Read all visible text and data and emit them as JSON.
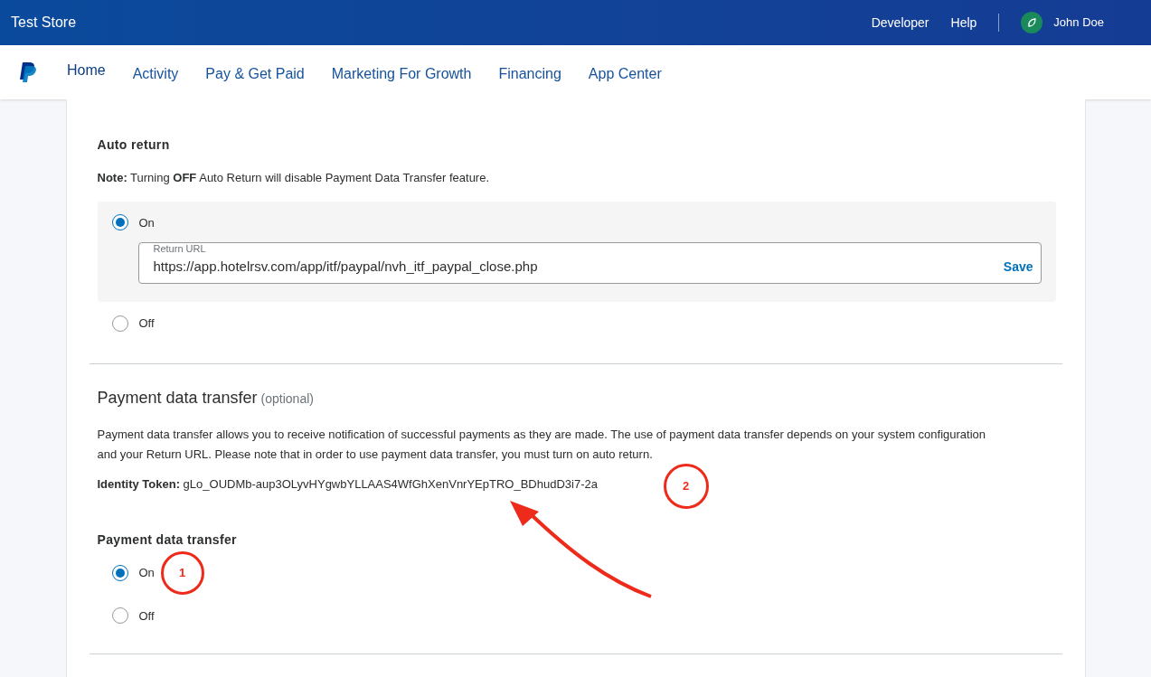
{
  "top_bar": {
    "store_name": "Test Store",
    "links": [
      "Developer",
      "Help"
    ],
    "user_name": "John Doe"
  },
  "nav": {
    "items": [
      {
        "label": "Home",
        "selected": true
      },
      {
        "label": "Activity",
        "selected": false
      },
      {
        "label": "Pay & Get Paid",
        "selected": false
      },
      {
        "label": "Marketing For Growth",
        "selected": false
      },
      {
        "label": "Financing",
        "selected": false
      },
      {
        "label": "App Center",
        "selected": false
      }
    ]
  },
  "auto_return": {
    "title": "Auto return",
    "note": "**Note:** Turning **OFF** Auto Return will disable Payment Data Transfer feature.",
    "options": [
      {
        "label": "On",
        "selected": true
      },
      {
        "label": "Off",
        "selected": false
      }
    ],
    "return_url": {
      "label": "Return URL",
      "value": "https://app.hotelrsv.com/app/itf/paypal/nvh_itf_paypal_close.php"
    },
    "save_button": "Save"
  },
  "payment_data_transfer": {
    "title": "Payment data transfer",
    "title_suffix": "(optional)",
    "description": "Payment data transfer allows you to receive notification of successful payments as they are made. The use of payment data transfer depends on your system configuration and your Return URL. Please note that in order to use payment data transfer, you must turn on auto return.",
    "identity_token": "**Identity Token:** gLo_OUDMb-aup3OLyvHYgwbYLLAAS4WfGhXenVnrYEpTRO_BDhudD3i7-2a",
    "setting_title": "Payment data transfer",
    "options": [
      {
        "label": "On",
        "selected": true
      },
      {
        "label": "Off",
        "selected": false
      }
    ]
  },
  "annotations": [
    "1",
    "2"
  ]
}
